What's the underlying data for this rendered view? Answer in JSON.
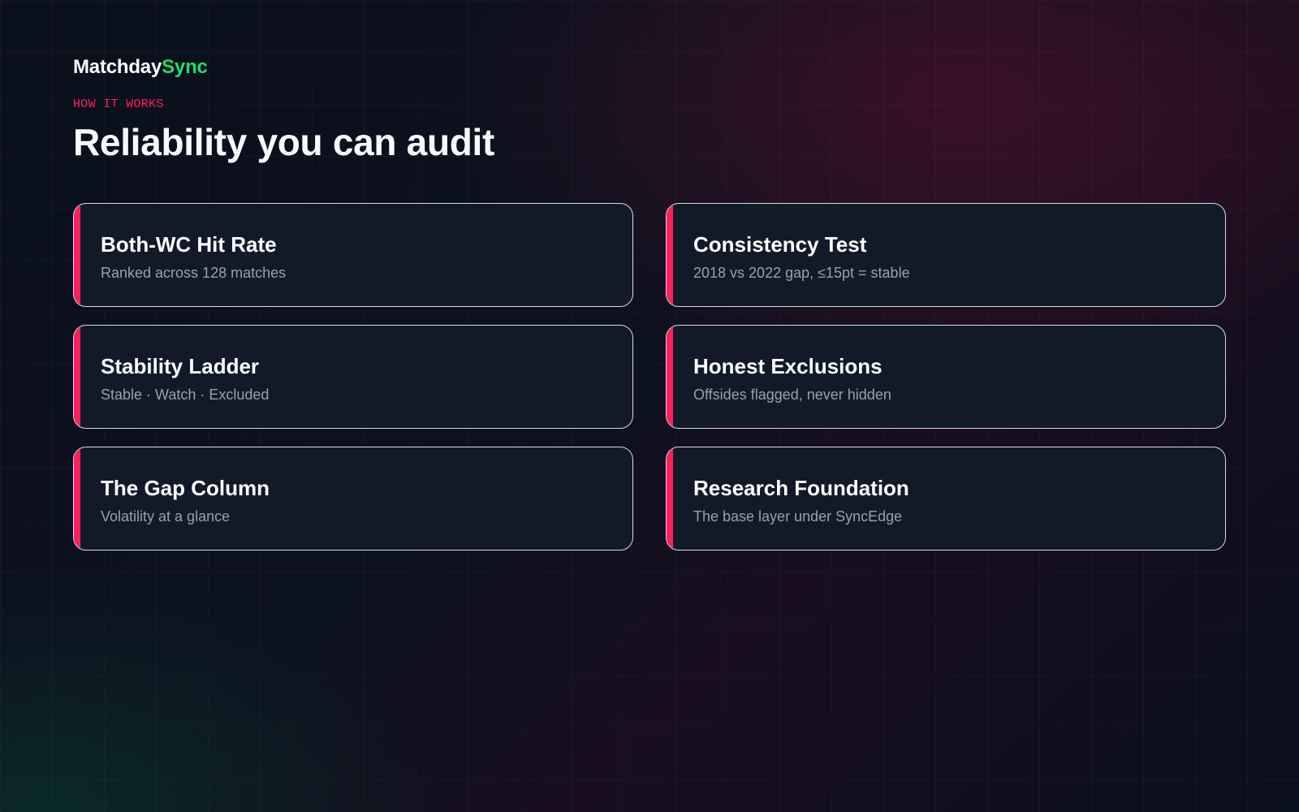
{
  "brand": {
    "name_part1": "Matchday",
    "name_part2": "Sync"
  },
  "section": {
    "eyebrow": "HOW IT WORKS",
    "headline": "Reliability you can audit"
  },
  "features": [
    {
      "title": "Both-WC Hit Rate",
      "description": "Ranked across 128 matches"
    },
    {
      "title": "Consistency Test",
      "description": "2018 vs 2022 gap, ≤15pt = stable"
    },
    {
      "title": "Stability Ladder",
      "description": "Stable · Watch · Excluded"
    },
    {
      "title": "Honest Exclusions",
      "description": "Offsides flagged, never hidden"
    },
    {
      "title": "The Gap Column",
      "description": "Volatility at a glance"
    },
    {
      "title": "Research Foundation",
      "description": "The base layer under SyncEdge"
    }
  ],
  "colors": {
    "accent": "#ff1f5a",
    "brand_green": "#22dd66",
    "background": "#0a0f1c",
    "card_background": "#121a29"
  }
}
